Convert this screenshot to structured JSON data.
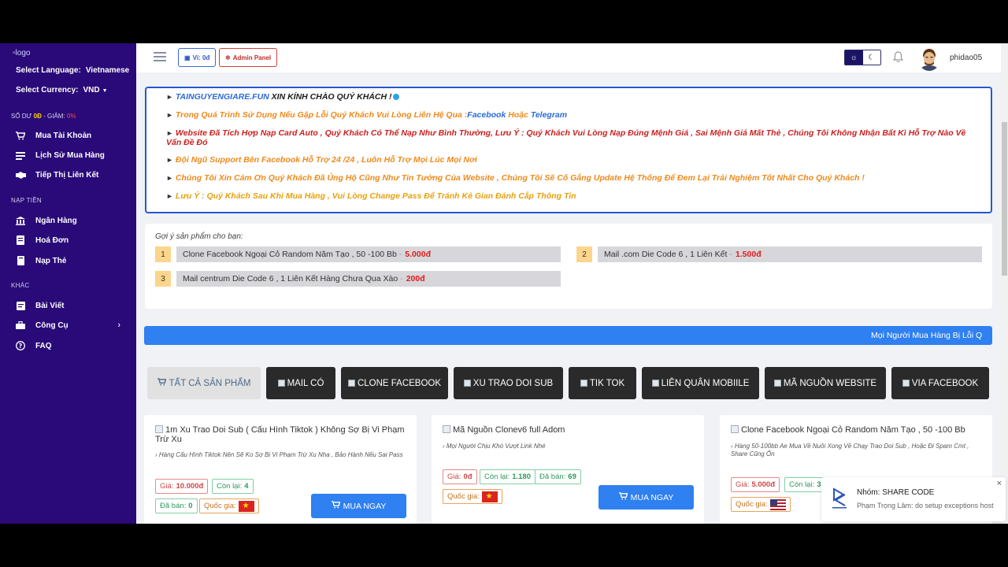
{
  "sidebar": {
    "logo_alt": "logo",
    "language_label": "Select Language:",
    "language_value": "Vietnamese",
    "currency_label": "Select Currency:",
    "currency_value": "VND",
    "balance_prefix": "SỐ DƯ",
    "balance_value": "0Đ",
    "balance_mid": "- GIẢM:",
    "discount_value": "0%",
    "items_main": [
      {
        "label": "Mua Tài Khoản",
        "icon": "cart-icon"
      },
      {
        "label": "Lịch Sử Mua Hàng",
        "icon": "history-icon"
      },
      {
        "label": "Tiếp Thị Liên Kết",
        "icon": "handshake-icon"
      }
    ],
    "section_deposit": "NẠP TIỀN",
    "items_deposit": [
      {
        "label": "Ngân Hàng",
        "icon": "bank-icon"
      },
      {
        "label": "Hoá Đơn",
        "icon": "invoice-icon"
      },
      {
        "label": "Nạp Thẻ",
        "icon": "card-icon"
      }
    ],
    "section_other": "KHÁC",
    "items_other": [
      {
        "label": "Bài Viết",
        "icon": "article-icon"
      },
      {
        "label": "Công Cụ",
        "icon": "toolbox-icon"
      },
      {
        "label": "FAQ",
        "icon": "question-icon"
      }
    ]
  },
  "topbar": {
    "wallet_label": "Ví: 0đ",
    "admin_label": "Admin Panel",
    "username": "phidao05"
  },
  "notice": {
    "l1_site": "TAINGUYENGIARE.FUN",
    "l1_text": " XIN KÍNH CHÀO QUÝ KHÁCH !",
    "l2_text": "Trong Quá Trình Sử Dụng Nếu Gặp Lỗi Quý Khách Vui Lòng Liên Hệ Qua :",
    "l2_facebook": "Facebook",
    "l2_or": " Hoặc ",
    "l2_telegram": "Telegram",
    "l3": "Website Đã Tích Hợp Nạp Card Auto , Quý Khách Có Thể Nạp Như Bình Thường, Lưu Ý : Quý Khách Vui Lòng Nạp Đúng Mệnh Giá , Sai Mệnh Giá Mất Thẻ , Chúng Tôi Không Nhận Bất Kì Hỗ Trợ Nào Về Vấn Đề Đó",
    "l4": "Đội Ngũ Support Bên Facebook Hỗ Trợ 24 /24 , Luôn Hỗ Trợ Mọi Lúc Mọi Nơi",
    "l5": "Chúng Tôi Xin Cảm Ơn Quý Khách Đã Ủng Hộ Cũng Như Tin Tưởng Của Website , Chúng Tôi Sẽ Cố Gắng Update Hệ Thống Để Đem Lại Trải Nghiệm Tốt Nhất Cho Quý Khách !",
    "l6": "Lưu Ý : Quý Khách Sau Khi Mua Hàng , Vui Lòng Change Pass Để Tránh Kẻ Gian Đánh Cắp Thông Tin"
  },
  "suggest": {
    "title": "Gợi ý sản phẩm cho bạn:",
    "items": [
      {
        "num": "1",
        "name": "Clone Facebook Ngoại Cỏ Random Năm Tạo , 50 -100 Bb",
        "price": "5.000đ"
      },
      {
        "num": "2",
        "name": "Mail .com Die Code 6 , 1 Liên Kết",
        "price": "1.500đ"
      },
      {
        "num": "3",
        "name": "Mail centrum Die Code 6 , 1 Liên Kết Hàng Chưa Qua Xào",
        "price": "200đ"
      }
    ]
  },
  "marquee": "Mọi Người Mua Hàng Bị Lỗi Q",
  "categories": [
    "TẤT CẢ SẢN PHẨM",
    "MAIL CÓ",
    "CLONE FACEBOOK",
    "XU TRAO DOI SUB",
    "TIK TOK",
    "LIÊN QUÂN MOBIILE",
    "MÃ NGUỒN WEBSITE",
    "VIA FACEBOOK"
  ],
  "labels": {
    "price": "Giá:",
    "stock": "Còn lại:",
    "sold": "Đã bán:",
    "country": "Quốc gia:",
    "buy": "MUA NGAY"
  },
  "products": [
    {
      "title": "1m Xu Trao Doi Sub ( Cấu Hình Tiktok ) Không Sợ Bị Vi Phạm Trừ Xu",
      "desc": "Hàng Cấu Hình Tiktok Nên Sẽ Ko Sợ Bị Vi Phạm Trừ Xu Nha , Bảo Hành Nếu Sai Pass",
      "price": "10.000đ",
      "stock": "4",
      "sold": "0",
      "country": "vn-flag-icon"
    },
    {
      "title": "Mã Nguồn Clonev6 full Adom",
      "desc": "Mọi Người Chịu Khó Vượt Link Nhé",
      "price": "0đ",
      "stock": "1.180",
      "sold": "69",
      "country": "vn-flag-icon"
    },
    {
      "title": "Clone Facebook Ngoại Cỏ Random Năm Tạo , 50 -100 Bb",
      "desc": "Hàng 50-100bb Ae Mua Về Nuôi Xong Về Chạy Trao Doi Sub , Hoặc Đi Spam Cmt , Share Cũng Ổn",
      "price": "5.000đ",
      "stock": "3",
      "country": "us-flag-icon"
    }
  ],
  "toast": {
    "title": "Nhóm: SHARE CODE",
    "body": "Phạm Trọng Lâm: do setup exceptions host",
    "close": "×"
  },
  "colors": {
    "sidebar_bg": "#2a0978",
    "primary": "#2f80f0",
    "notice_border": "#2757cf",
    "price_red": "#e21b1b"
  }
}
